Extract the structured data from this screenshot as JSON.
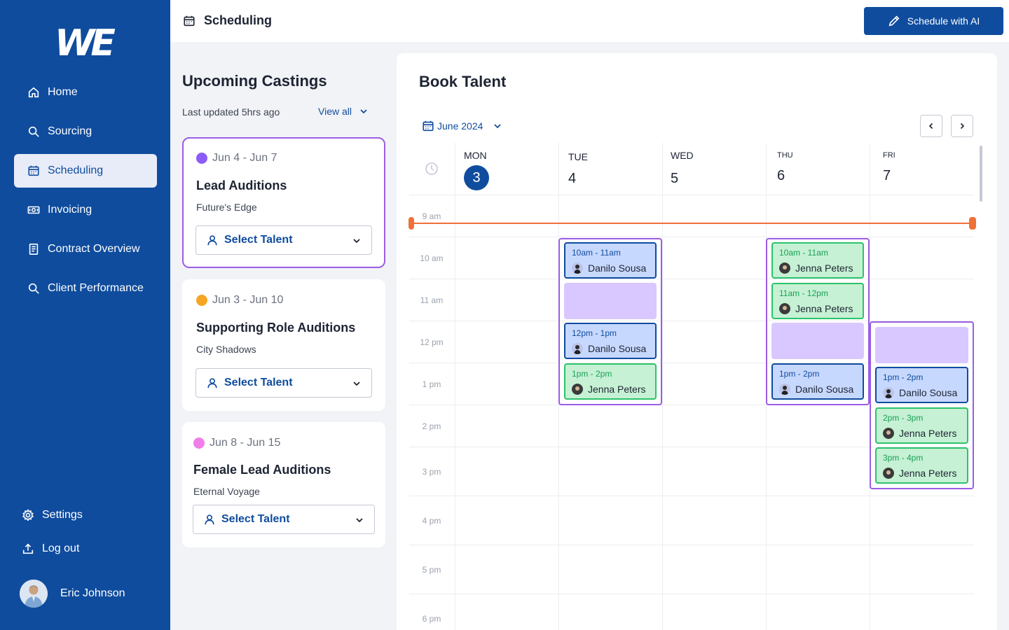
{
  "sidebar": {
    "logo": "WE",
    "nav": [
      {
        "label": "Home",
        "icon": "home-icon"
      },
      {
        "label": "Sourcing",
        "icon": "search-icon"
      },
      {
        "label": "Scheduling",
        "icon": "calendar-icon",
        "active": true
      },
      {
        "label": "Invoicing",
        "icon": "money-icon"
      },
      {
        "label": "Contract Overview",
        "icon": "document-icon"
      },
      {
        "label": "Client Performance",
        "icon": "search-icon"
      }
    ],
    "settings_label": "Settings",
    "logout_label": "Log out",
    "user_name": "Eric Johnson"
  },
  "header": {
    "title": "Scheduling",
    "ai_button": "Schedule with AI"
  },
  "castings": {
    "title": "Upcoming Castings",
    "updated": "Last updated 5hrs ago",
    "view_all": "View all",
    "cards": [
      {
        "dates": "Jun 4 - Jun 7",
        "title": "Lead Auditions",
        "subtitle": "Future's Edge",
        "select_label": "Select Talent",
        "dot_color": "#8b5cf6"
      },
      {
        "dates": "Jun 3 - Jun 10",
        "title": "Supporting Role Auditions",
        "subtitle": "City Shadows",
        "select_label": "Select Talent",
        "dot_color": "#f5a623"
      },
      {
        "dates": "Jun 8 - Jun 15",
        "title": "Female Lead Auditions",
        "subtitle": "Eternal Voyage",
        "select_label": "Select Talent",
        "dot_color": "#f07ee8"
      }
    ]
  },
  "booking": {
    "title": "Book Talent",
    "month": "June 2024",
    "days": [
      {
        "name": "MON",
        "num": "3",
        "today": true
      },
      {
        "name": "TUE",
        "num": "4"
      },
      {
        "name": "WED",
        "num": "5"
      },
      {
        "name": "THU",
        "num": "6"
      },
      {
        "name": "FRI",
        "num": "7"
      }
    ],
    "times": [
      "9 am",
      "10 am",
      "11 am",
      "12 pm",
      "1 pm",
      "2 pm",
      "3 pm",
      "4 pm",
      "5 pm",
      "6 pm"
    ],
    "tue": [
      {
        "time": "10am - 11am",
        "person": "Danilo Sousa"
      },
      {
        "time": "12pm - 1pm",
        "person": "Danilo Sousa"
      },
      {
        "time": "1pm - 2pm",
        "person": "Jenna Peters"
      }
    ],
    "thu": [
      {
        "time": "10am - 11am",
        "person": "Jenna Peters"
      },
      {
        "time": "11am - 12pm",
        "person": "Jenna Peters"
      },
      {
        "time": "1pm - 2pm",
        "person": "Danilo Sousa"
      }
    ],
    "fri": [
      {
        "time": "1pm - 2pm",
        "person": "Danilo Sousa"
      },
      {
        "time": "2pm - 3pm",
        "person": "Jenna Peters"
      },
      {
        "time": "3pm - 4pm",
        "person": "Jenna Peters"
      }
    ],
    "colors": {
      "booked_blue": "#c7d8ff",
      "booked_green": "#c6f1d4",
      "open_slot": "#d9c8ff",
      "current_time": "#f0703a",
      "brand": "#0f4c9e"
    }
  }
}
